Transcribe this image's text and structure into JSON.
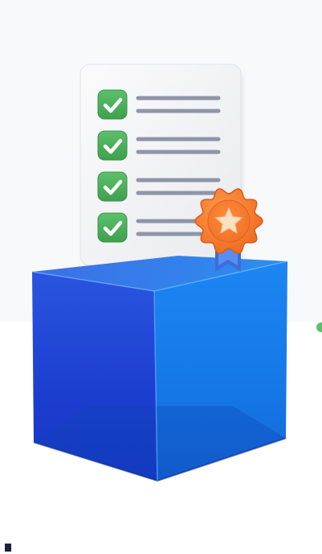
{
  "illustration": {
    "checklist_items": [
      {
        "checked": true,
        "icon": "checkmark-icon"
      },
      {
        "checked": true,
        "icon": "checkmark-icon"
      },
      {
        "checked": true,
        "icon": "checkmark-icon"
      },
      {
        "checked": true,
        "icon": "checkmark-icon"
      }
    ],
    "badge_icon": "star-icon",
    "colors": {
      "cube_top": "#2f7fe6",
      "cube_left": "#1d3fd0",
      "cube_right": "#1b7fee",
      "check_green": "#4caf59",
      "badge_orange": "#f4762a",
      "badge_ribbon": "#3a6fd8",
      "paper": "#f4f4f6",
      "lines": "#8e95a8"
    }
  }
}
